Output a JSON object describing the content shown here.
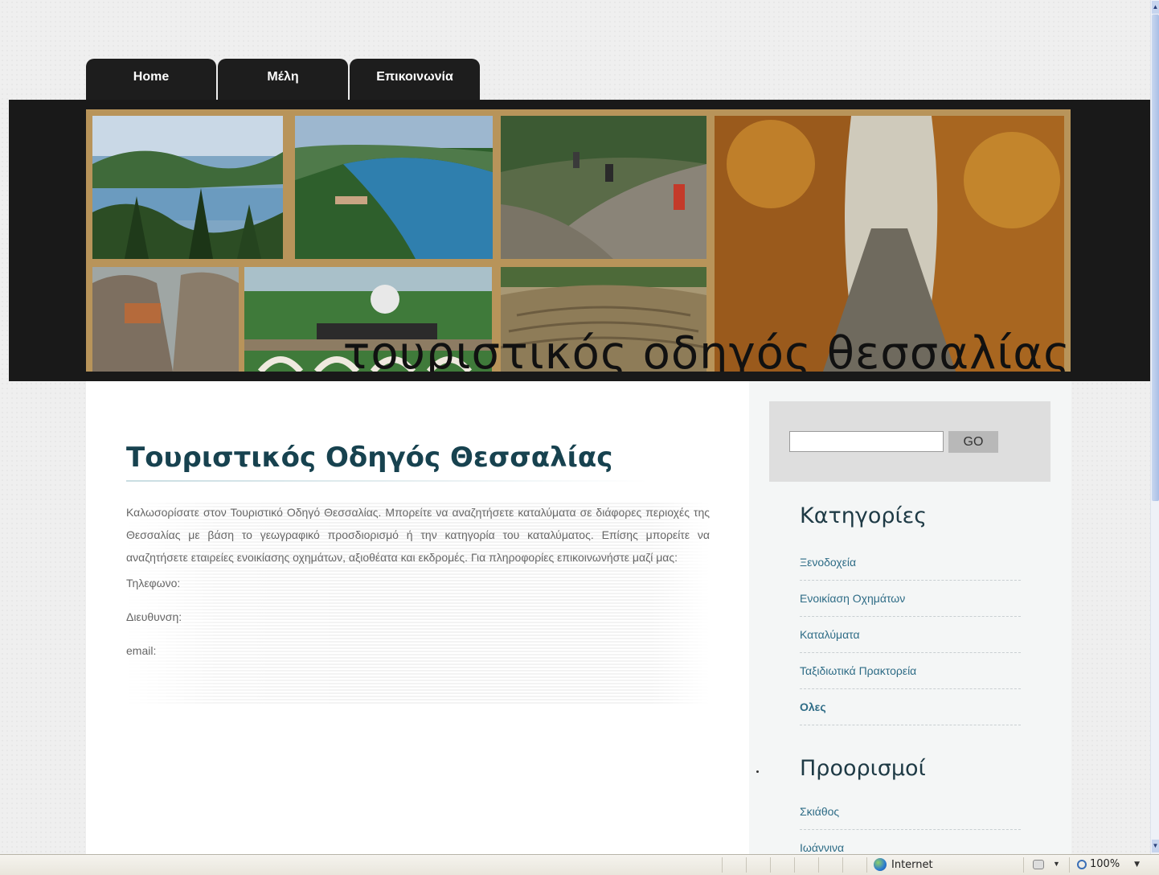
{
  "nav": {
    "tabs": [
      {
        "label": "Home"
      },
      {
        "label": "Μέλη"
      },
      {
        "label": "Επικοινωνία"
      }
    ]
  },
  "banner": {
    "title": "τουριστικός οδηγός θεσσαλίας"
  },
  "main": {
    "title": "Τουριστικός Οδηγός Θεσσαλίας",
    "intro": "Καλωσορίσατε στον Τουριστικό Οδηγό Θεσσαλίας. Μπορείτε να αναζητήσετε καταλύματα σε διάφορες περιοχές της Θεσσαλίας με βάση το γεωγραφικό προσδιορισμό ή την κατηγορία του καταλύματος. Επίσης μπορείτε να αναζητήσετε εταιρείες ενοικίασης οχημάτων, αξιοθέατα και εκδρομές. Για πληροφορίες επικοινωνήστε μαζί μας:",
    "phone_label": "Τηλεφωνο:",
    "address_label": "Διευθυνση:",
    "email_label": "email:"
  },
  "sidebar": {
    "search": {
      "value": "",
      "go_label": "GO"
    },
    "categories_heading": "Κατηγορίες",
    "categories": [
      {
        "label": "Ξενοδοχεία"
      },
      {
        "label": "Ενοικίαση Οχημάτων"
      },
      {
        "label": "Καταλύματα"
      },
      {
        "label": "Ταξιδιωτικά Πρακτορεία"
      },
      {
        "label": "Ολες"
      }
    ],
    "destinations_heading": "Προορισμοί",
    "destinations": [
      {
        "label": "Σκιάθος"
      },
      {
        "label": "Ιωάννινα"
      }
    ]
  },
  "statusbar": {
    "zone": "Internet",
    "zoom": "100%"
  },
  "colors": {
    "nav_bg": "#1d1d1d",
    "title_color": "#17424f",
    "link_color": "#2e6c86",
    "banner_frame": "#b8945a"
  }
}
